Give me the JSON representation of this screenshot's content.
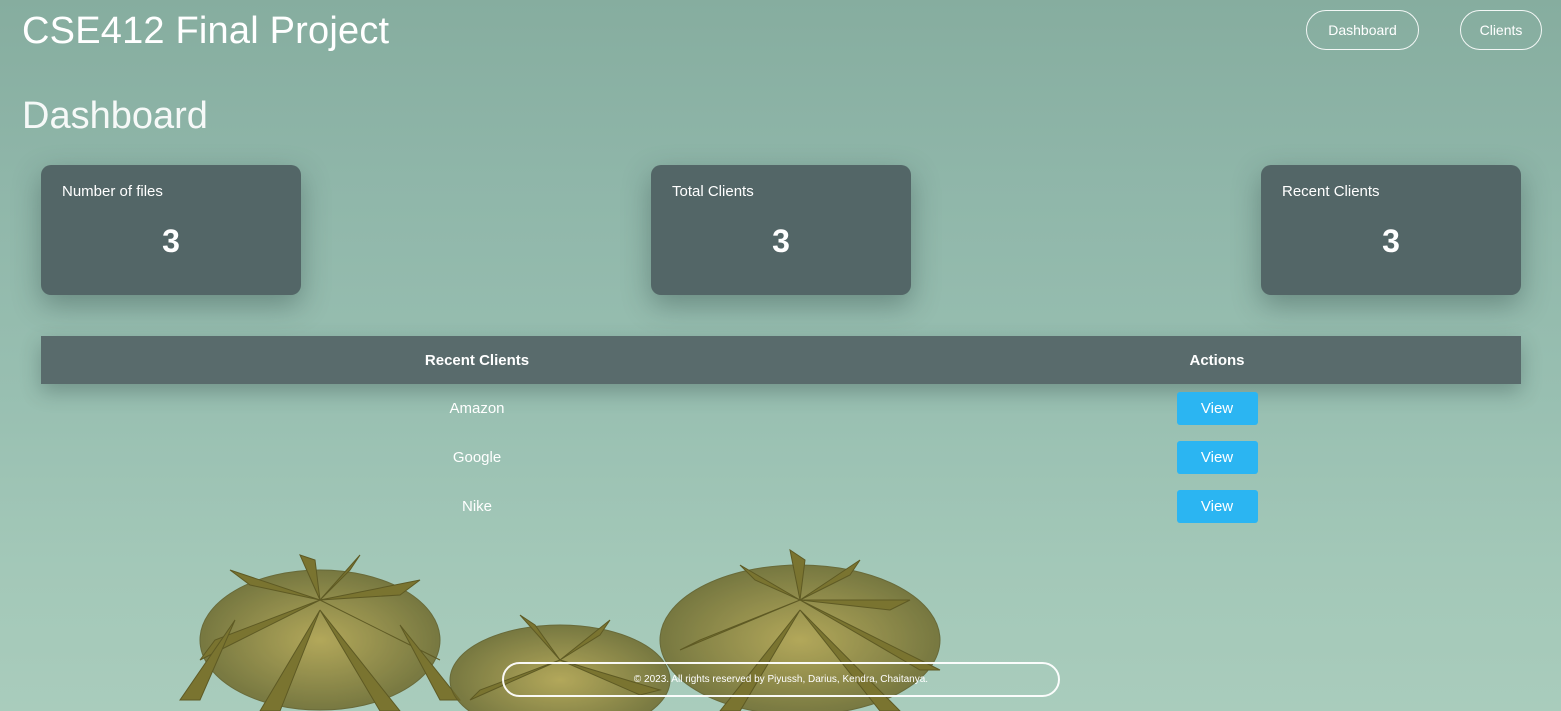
{
  "header": {
    "title": "CSE412 Final Project",
    "nav": {
      "dashboard_label": "Dashboard",
      "clients_label": "Clients"
    }
  },
  "page": {
    "heading": "Dashboard"
  },
  "stats": [
    {
      "label": "Number of files",
      "value": "3"
    },
    {
      "label": "Total Clients",
      "value": "3"
    },
    {
      "label": "Recent Clients",
      "value": "3"
    }
  ],
  "table": {
    "headers": [
      "Recent Clients",
      "Actions"
    ],
    "rows": [
      {
        "client": "Amazon",
        "action_label": "View"
      },
      {
        "client": "Google",
        "action_label": "View"
      },
      {
        "client": "Nike",
        "action_label": "View"
      }
    ]
  },
  "footer": {
    "text": "© 2023. All rights reserved by Piyussh, Darius, Kendra, Chaitanya."
  },
  "theme": {
    "card_bg": "#536667",
    "table_header_bg": "#596b6c",
    "view_button_bg": "#2bb5f2",
    "background_tint": "#98bfb1",
    "text_color": "#ffffff"
  },
  "background_image": "palm-trees-photo"
}
